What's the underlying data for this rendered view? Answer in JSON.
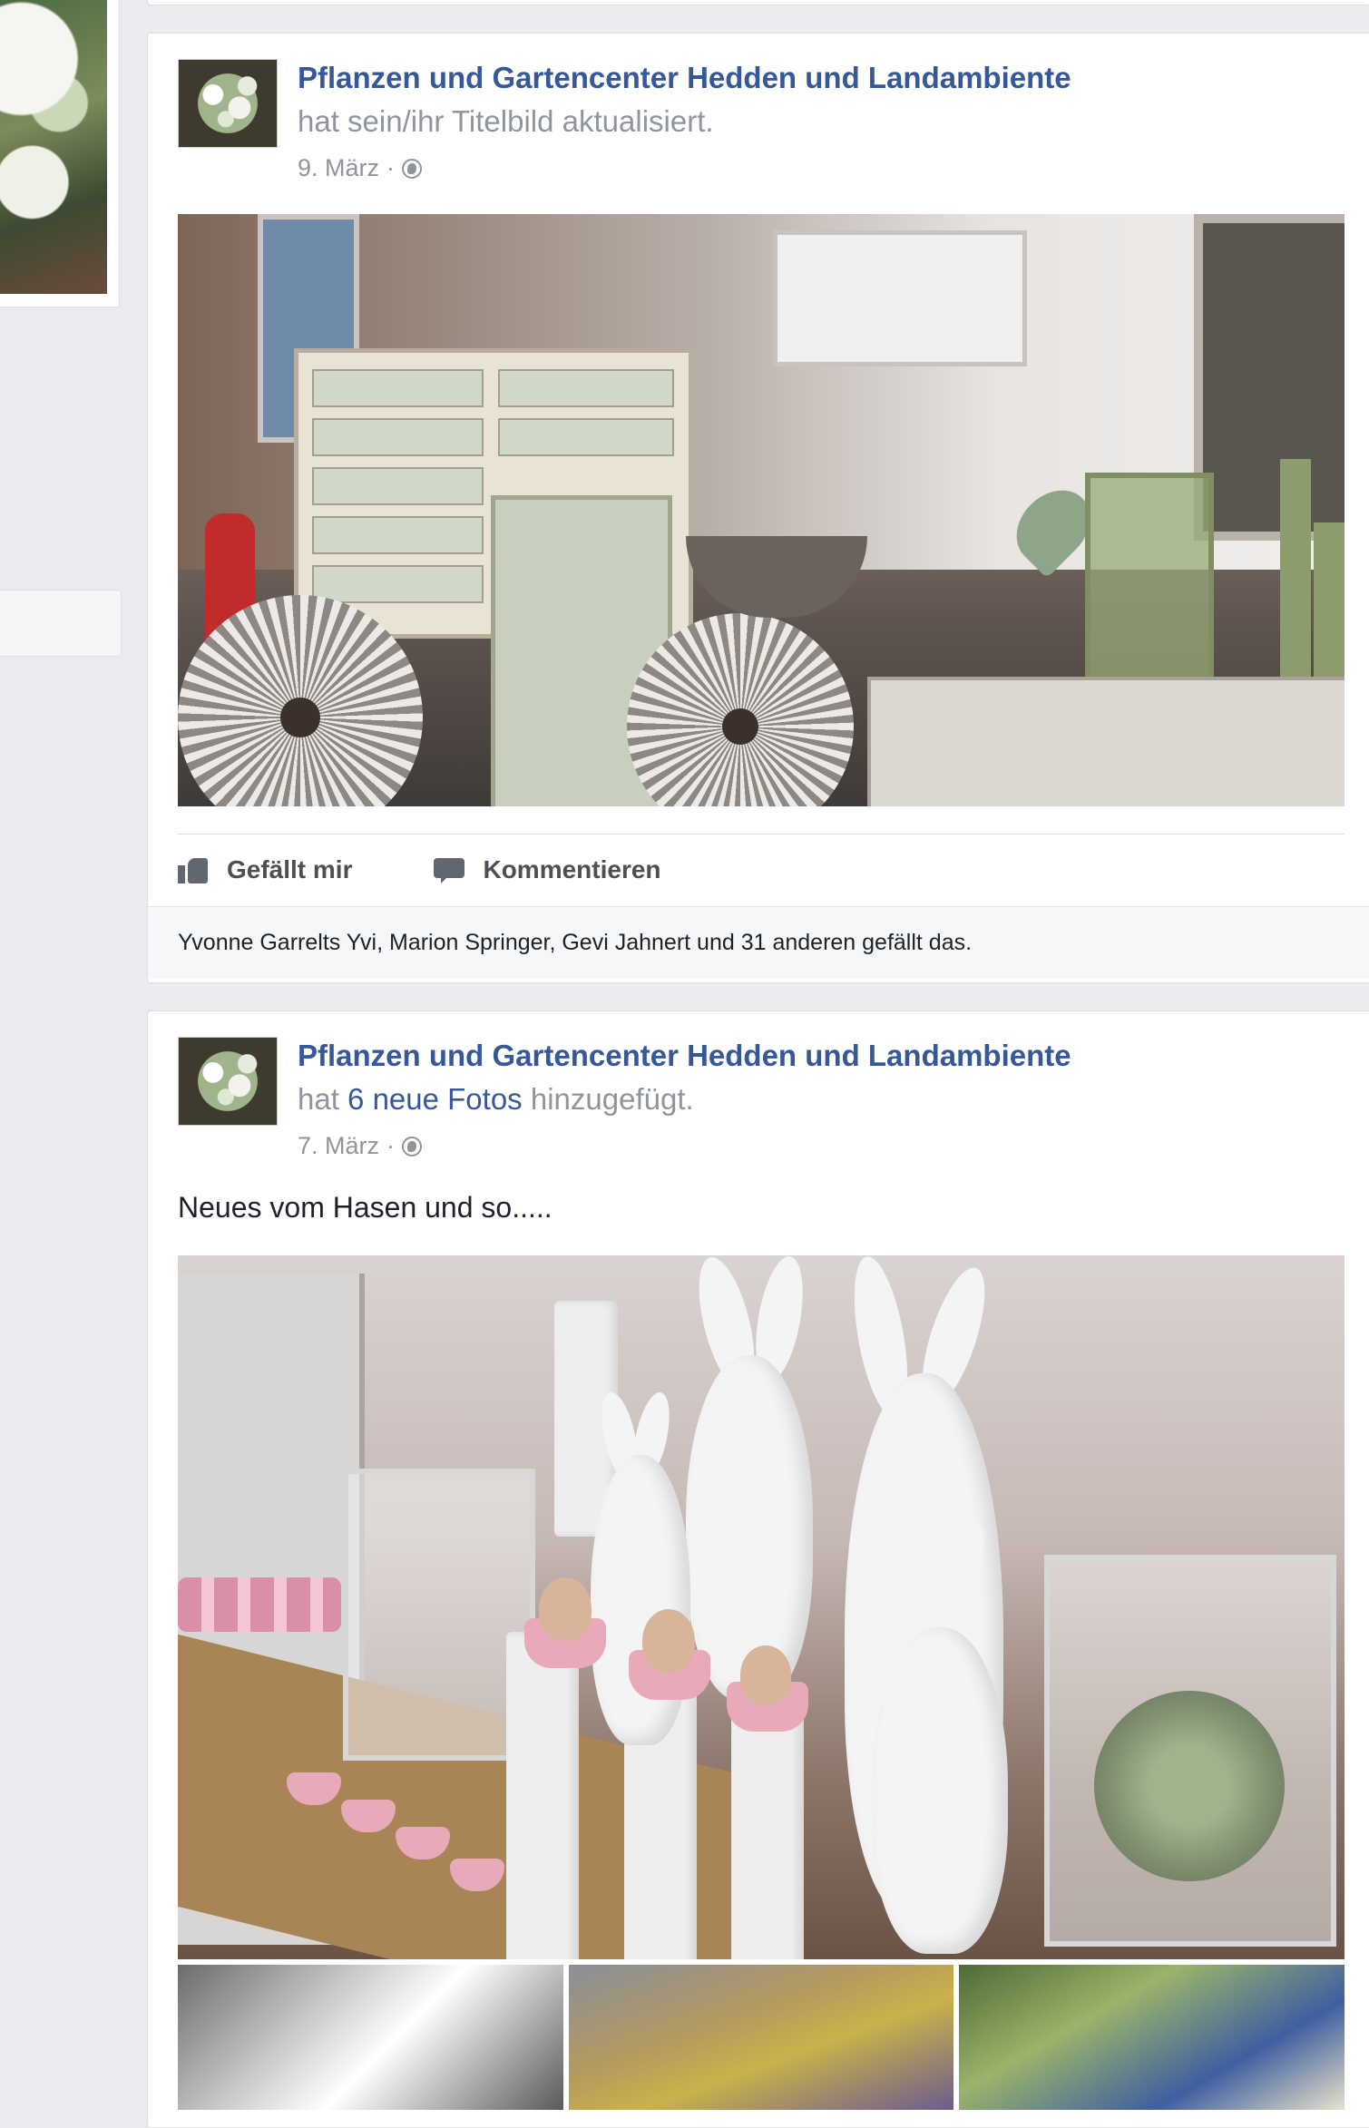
{
  "posts": [
    {
      "page_name": "Pflanzen und Gartencenter Hedden und Landambiente",
      "story": "hat sein/ihr Titelbild aktualisiert.",
      "date": "9. März",
      "date_sep": "·",
      "actions": {
        "like": "Gefällt mir",
        "comment": "Kommentieren"
      },
      "likes_summary": "Yvonne Garrelts Yvi, Marion Springer, Gevi Jahnert und 31 anderen gefällt das."
    },
    {
      "page_name": "Pflanzen und Gartencenter Hedden und Landambiente",
      "story_prefix": "hat",
      "story_link": "6 neue Fotos",
      "story_suffix": "hinzugefügt.",
      "date": "7. März",
      "date_sep": "·",
      "text": "Neues vom Hasen und so....."
    }
  ],
  "icons": {
    "audience": "globe-icon",
    "like": "thumbs-up-icon",
    "comment": "speech-bubble-icon"
  },
  "colors": {
    "link": "#365899",
    "meta": "#90949c",
    "background": "#e9ebee"
  }
}
